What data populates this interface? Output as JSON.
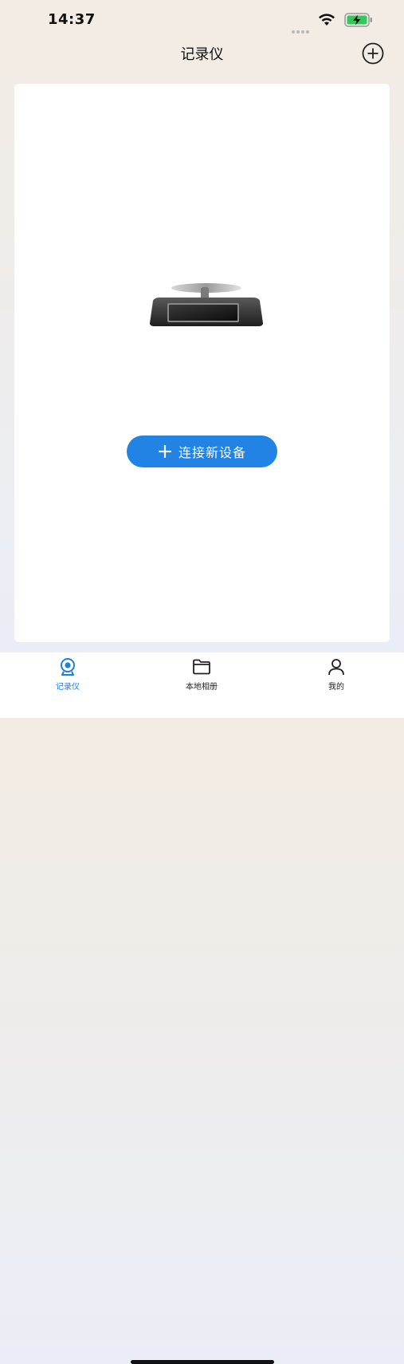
{
  "status_bar": {
    "time": "14:37",
    "wifi_icon": "wifi-icon",
    "battery_icon": "battery-charging-icon",
    "battery_color": "#34c759"
  },
  "nav": {
    "title": "记录仪",
    "add_icon": "plus-circle-icon"
  },
  "main": {
    "device_image": "dashcam-device-image",
    "connect_button_label": "连接新设备",
    "accent_color": "#2183e3"
  },
  "tab_bar": {
    "tabs": [
      {
        "label": "记录仪",
        "icon": "camera-icon",
        "active": true
      },
      {
        "label": "本地相册",
        "icon": "folder-icon",
        "active": false
      },
      {
        "label": "我的",
        "icon": "user-icon",
        "active": false
      }
    ],
    "active_color": "#1f7fe0"
  }
}
